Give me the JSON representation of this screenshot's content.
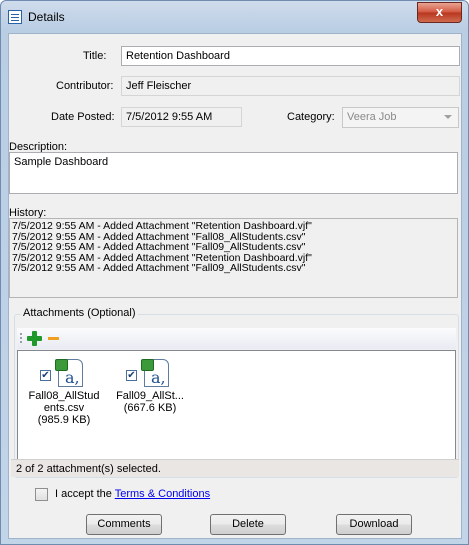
{
  "window": {
    "title": "Details",
    "close_glyph": "x"
  },
  "form": {
    "title_label": "Title:",
    "title_value": "Retention Dashboard",
    "contributor_label": "Contributor:",
    "contributor_value": "Jeff Fleischer",
    "date_label": "Date Posted:",
    "date_value": "7/5/2012 9:55 AM",
    "category_label": "Category:",
    "category_value": "Veera Job",
    "description_label": "Description:",
    "description_value": "Sample Dashboard",
    "history_label": "History:",
    "history": [
      "7/5/2012 9:55 AM - Added Attachment \"Retention Dashboard.vjf\"",
      "7/5/2012 9:55 AM - Added Attachment \"Fall08_AllStudents.csv\"",
      "7/5/2012 9:55 AM - Added Attachment \"Fall09_AllStudents.csv\"",
      "7/5/2012 9:55 AM - Added Attachment \"Retention Dashboard.vjf\"",
      "7/5/2012 9:55 AM - Added Attachment \"Fall09_AllStudents.csv\""
    ]
  },
  "attachments": {
    "label": "Attachments (Optional)",
    "items": [
      {
        "name_line1": "Fall08_AllStud",
        "name_line2": "ents.csv",
        "size": "(985.9 KB)",
        "checked": true
      },
      {
        "name_line1": "Fall09_AllSt...",
        "name_line2": "(667.6 KB)",
        "size": "",
        "checked": true
      }
    ],
    "status": "2 of 2 attachment(s) selected."
  },
  "accept": {
    "prefix": "I accept the",
    "link": "Terms & Conditions"
  },
  "buttons": {
    "comments": "Comments",
    "delete": "Delete",
    "download": "Download"
  },
  "colors": {
    "link": "#0000ee",
    "add": "#1f9a2a",
    "remove": "#f0a020",
    "close": "#c4472f"
  },
  "icons": [
    "details-window-icon",
    "close-icon",
    "add-icon",
    "remove-icon",
    "excel-file-icon",
    "dropdown-arrow-icon"
  ]
}
